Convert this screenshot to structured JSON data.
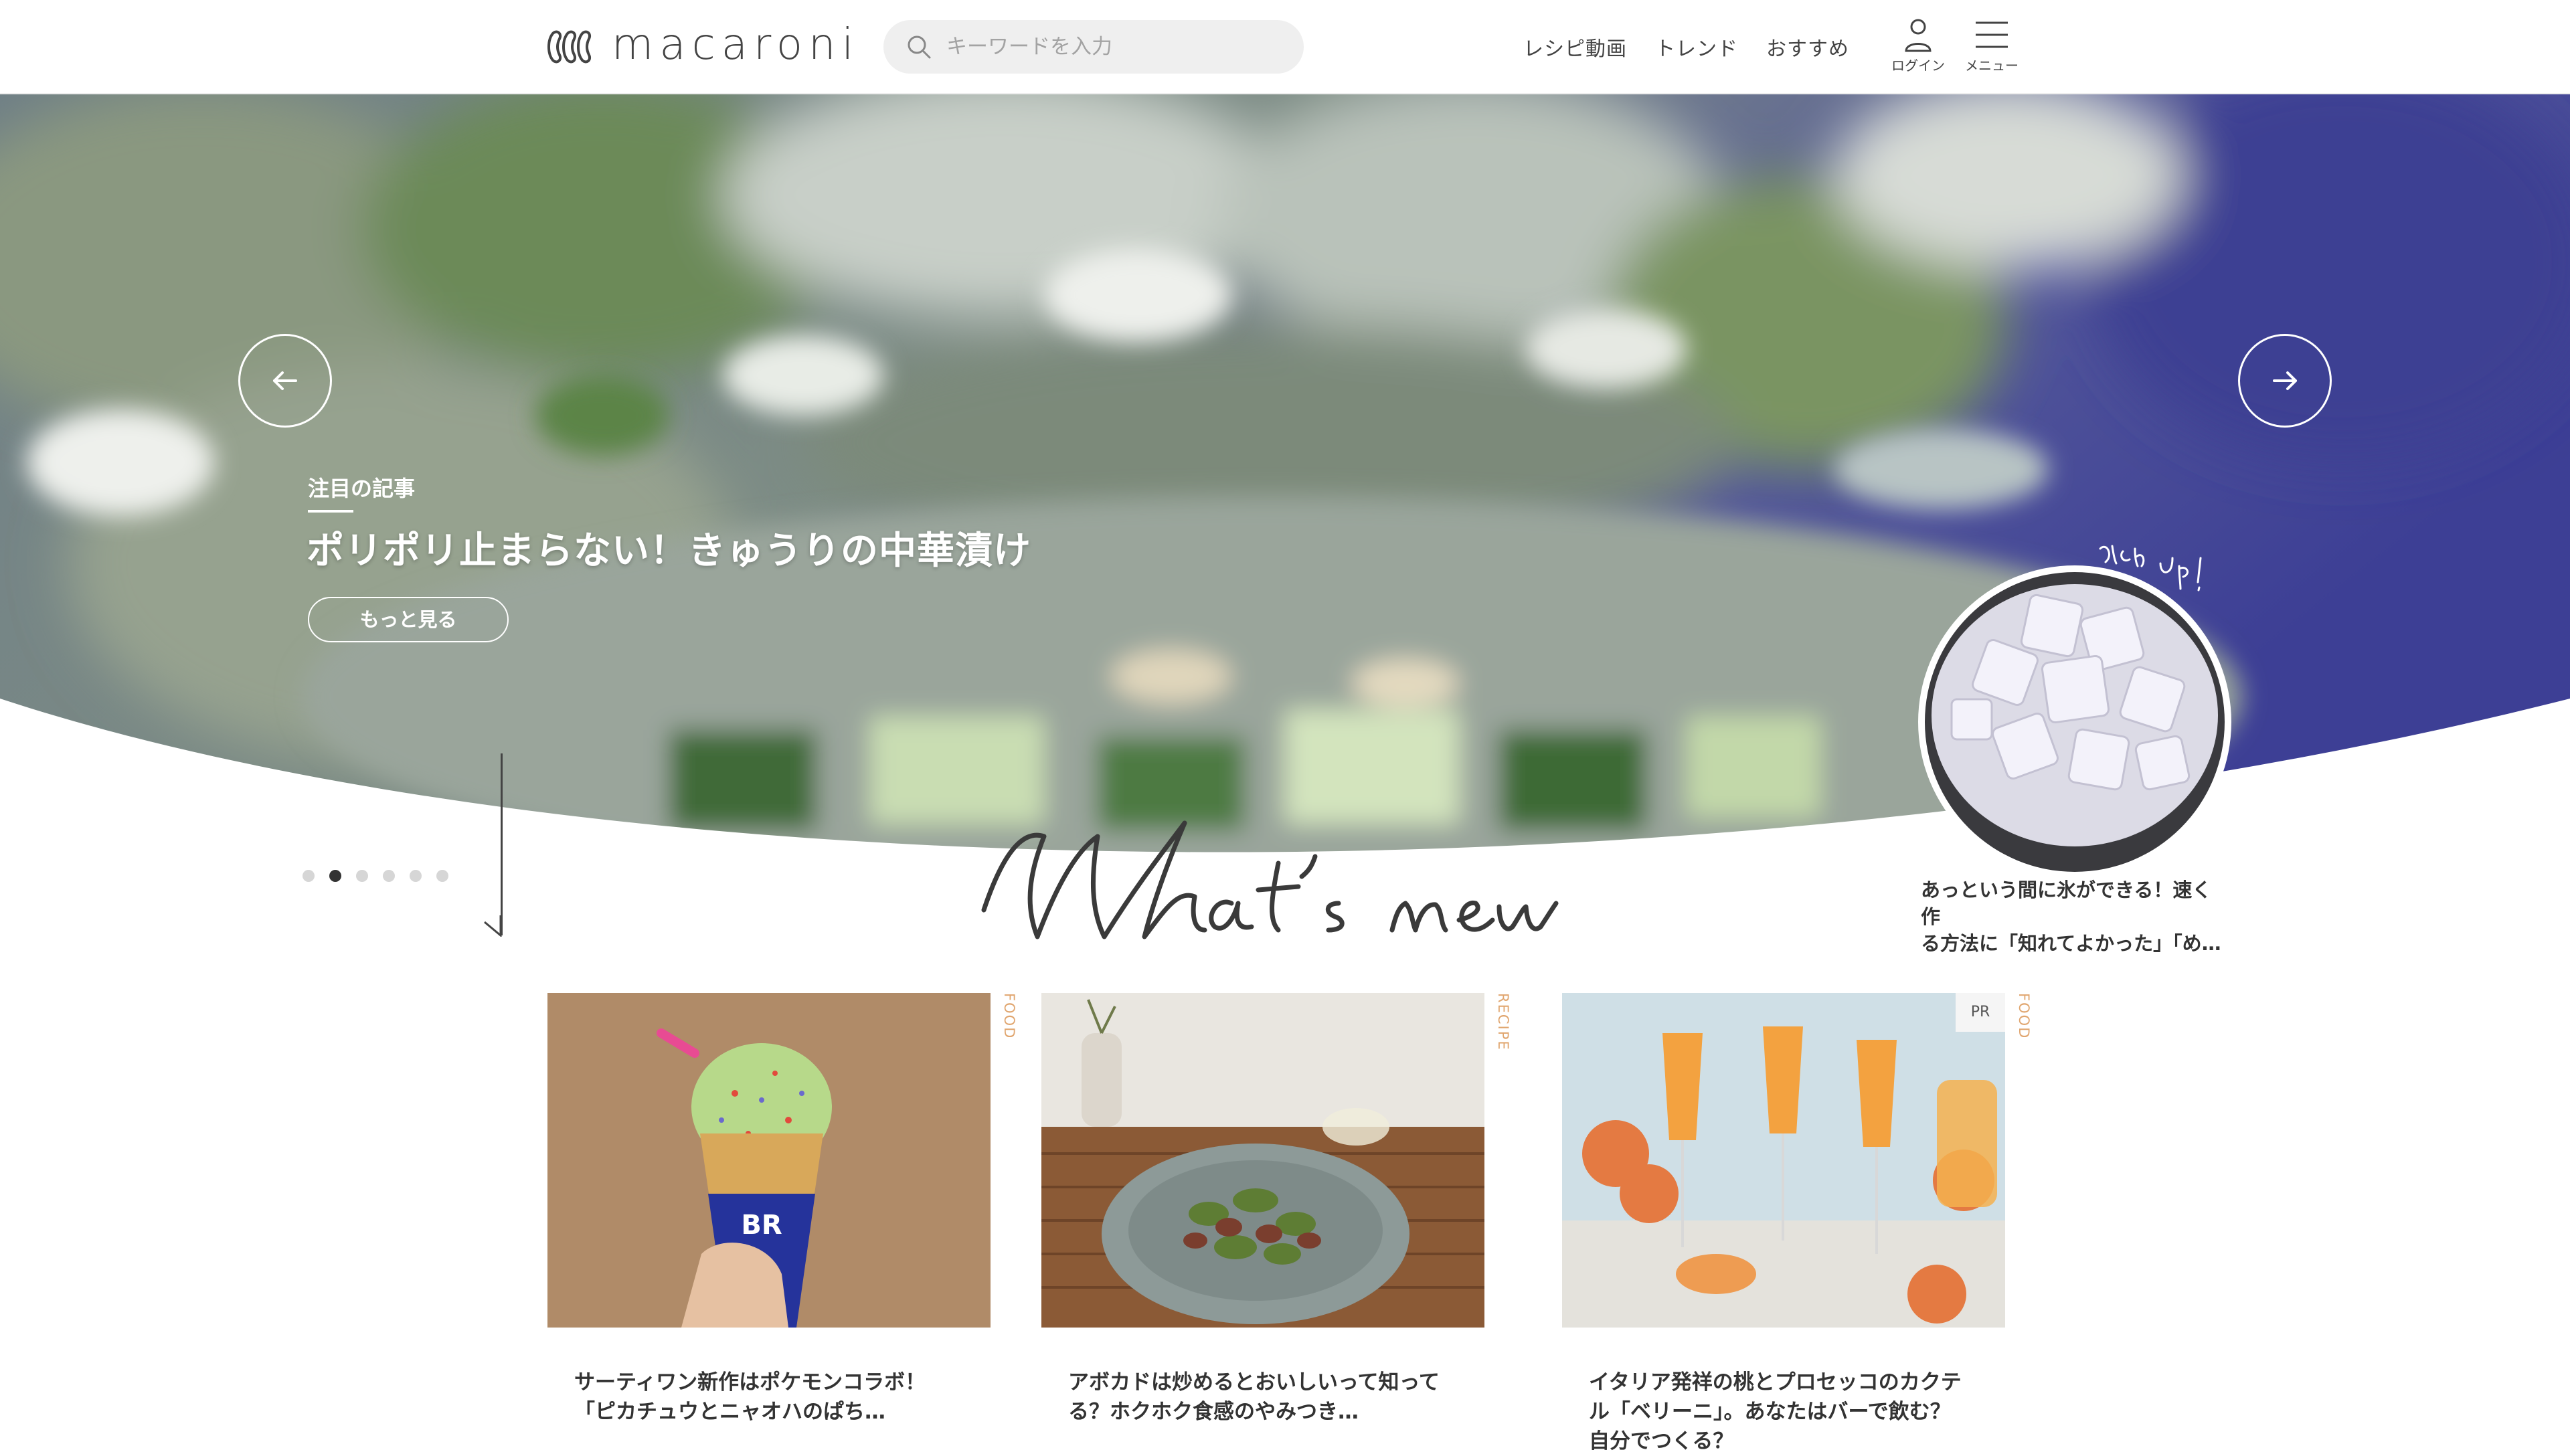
{
  "header": {
    "logo_text": "macaroni",
    "search_placeholder": "キーワードを入力",
    "nav": [
      "レシピ動画",
      "トレンド",
      "おすすめ"
    ],
    "login_label": "ログイン",
    "menu_label": "メニュー"
  },
  "hero": {
    "label": "注目の記事",
    "title": "ポリポリ止まらない！きゅうりの中華漬け",
    "more_label": "もっと見る",
    "active_slide": 2,
    "slide_count": 6
  },
  "pickup": {
    "caption_line1": "あっという間に氷ができる！速く作",
    "caption_line2": "る方法に「知れてよかった」「め…"
  },
  "cards": [
    {
      "category": "FOOD",
      "pr": "",
      "title_line1": "サーティワン新作はポケモンコラボ！",
      "title_line2": "「ピカチュウとニャオハのぱち…",
      "title_line3": ""
    },
    {
      "category": "RECIPE",
      "pr": "",
      "title_line1": "アボカドは炒めるとおいしいって知って",
      "title_line2": "る？ホクホク食感のやみつき…",
      "title_line3": ""
    },
    {
      "category": "FOOD",
      "pr": "PR",
      "title_line1": "イタリア発祥の桃とプロセッコのカクテ",
      "title_line2": "ル「ベリーニ」。あなたはバーで飲む？",
      "title_line3": "自分でつくる？"
    }
  ],
  "colors": {
    "accent_category": "#e0a56e",
    "text": "#333333"
  }
}
